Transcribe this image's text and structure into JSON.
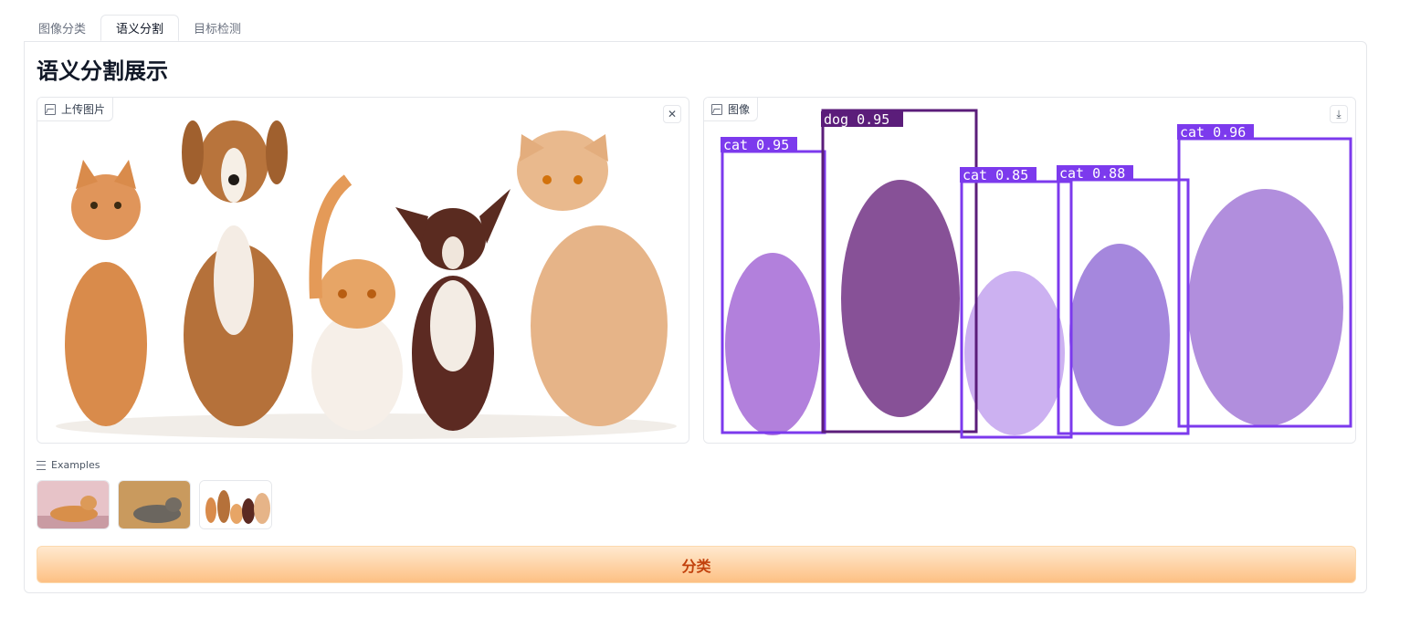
{
  "tabs": [
    {
      "label": "图像分类",
      "active": false
    },
    {
      "label": "语义分割",
      "active": true
    },
    {
      "label": "目标检测",
      "active": false
    }
  ],
  "page_title": "语义分割展示",
  "input_image": {
    "label": "上传图片",
    "clear_icon": "close-icon",
    "content": "a row of cats and dogs on a white background"
  },
  "output_image": {
    "label": "图像",
    "download_icon": "download-icon",
    "detections": [
      {
        "label": "cat 0.95"
      },
      {
        "label": "dog 0.95"
      },
      {
        "label": "cat 0.85"
      },
      {
        "label": "cat 0.88"
      },
      {
        "label": "cat 0.96"
      }
    ]
  },
  "examples": {
    "label": "Examples",
    "items": [
      "example-dog-lying",
      "example-cat-lying",
      "example-pets-row"
    ]
  },
  "action_button": {
    "label": "分类"
  },
  "colors": {
    "accent": "#f97316",
    "mask": "#8b5cf6",
    "box": "#7c3aed"
  }
}
